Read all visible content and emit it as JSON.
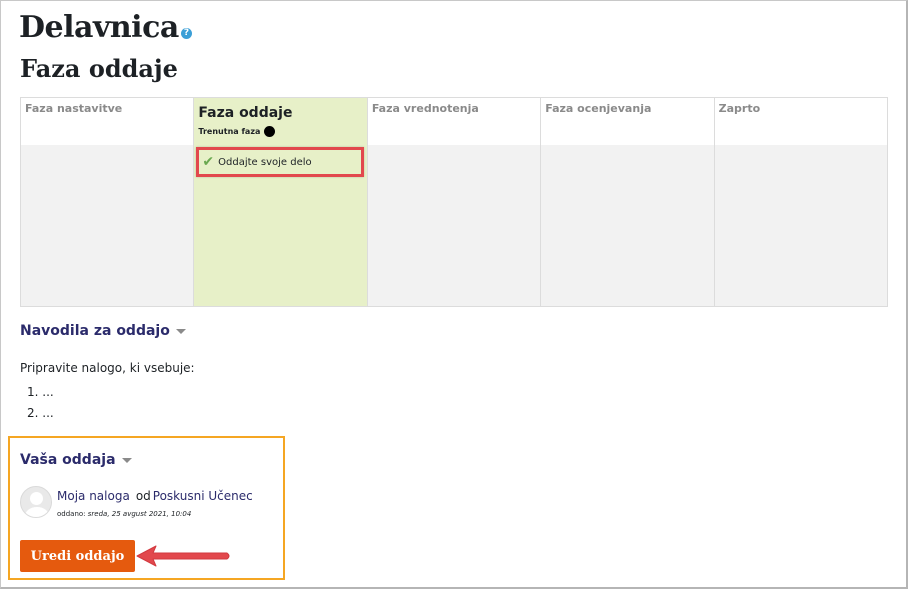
{
  "page": {
    "title": "Delavnica",
    "subtitle": "Faza oddaje"
  },
  "phases": [
    {
      "name": "Faza nastavitve",
      "active": false
    },
    {
      "name": "Faza oddaje",
      "active": true,
      "current_label": "Trenutna faza",
      "task": "Oddajte svoje delo",
      "task_done": true
    },
    {
      "name": "Faza vrednotenja",
      "active": false
    },
    {
      "name": "Faza ocenjevanja",
      "active": false
    },
    {
      "name": "Zaprto",
      "active": false
    }
  ],
  "instructions": {
    "heading": "Navodila za oddajo",
    "text": "Pripravite nalogo, ki vsebuje:",
    "items": [
      "...",
      "..."
    ]
  },
  "submission": {
    "heading": "Vaša oddaja",
    "title": "Moja naloga",
    "by_label": "od",
    "author": "Poskusni Učenec",
    "meta_label": "oddano:",
    "meta_date": "sreda, 25 avgust 2021, 10:04",
    "edit_label": "Uredi oddajo"
  },
  "colors": {
    "active_phase": "#e7f0c8",
    "highlight_red": "#e2484d",
    "highlight_orange": "#f5a623",
    "button": "#e55a0e",
    "link": "#2b2b6b"
  },
  "icons": [
    "help-icon",
    "check-icon",
    "current-phase-dot-icon",
    "collapse-caret-icon",
    "avatar-icon",
    "arrow-icon"
  ]
}
